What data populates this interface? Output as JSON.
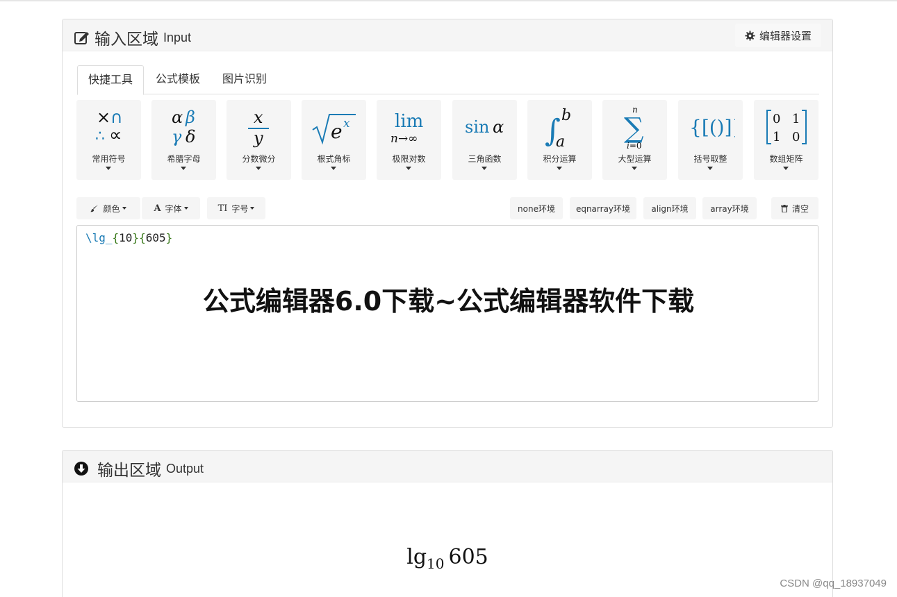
{
  "input_panel": {
    "title": "输入区域",
    "title_en": "Input",
    "settings_label": "编辑器设置",
    "tabs": [
      "快捷工具",
      "公式模板",
      "图片识别"
    ],
    "tools": [
      {
        "label": "常用符号",
        "symbol": "×∩ ∴∝"
      },
      {
        "label": "希腊字母",
        "symbol": "αβ γδ"
      },
      {
        "label": "分数微分",
        "symbol": "x/y"
      },
      {
        "label": "根式角标",
        "symbol": "√eˣ"
      },
      {
        "label": "极限对数",
        "symbol": "lim n→∞"
      },
      {
        "label": "三角函数",
        "symbol": "sin α"
      },
      {
        "label": "积分运算",
        "symbol": "∫ₐᵇ"
      },
      {
        "label": "大型运算",
        "symbol": "∑ i=0 n"
      },
      {
        "label": "括号取整",
        "symbol": "{[()]}"
      },
      {
        "label": "数组矩阵",
        "symbol": "[0 1; 1 0]"
      }
    ],
    "format_buttons": {
      "color": "颜色",
      "font": "字体",
      "size": "字号",
      "none_env": "none环境",
      "eqnarray_env": "eqnarray环境",
      "align_env": "align环境",
      "array_env": "array环境",
      "clear": "清空"
    },
    "editor": {
      "cmd": "\\lg_",
      "open1": "{",
      "arg1": "10",
      "close1": "}",
      "open2": "{",
      "arg2": "605",
      "close2": "}"
    }
  },
  "overlay_title": "公式编辑器6.0下载~公式编辑器软件下载",
  "output_panel": {
    "title": "输出区域",
    "title_en": "Output",
    "math_base": "lg",
    "math_sub": "10",
    "math_arg": "605"
  },
  "watermark": "CSDN @qq_18937049"
}
